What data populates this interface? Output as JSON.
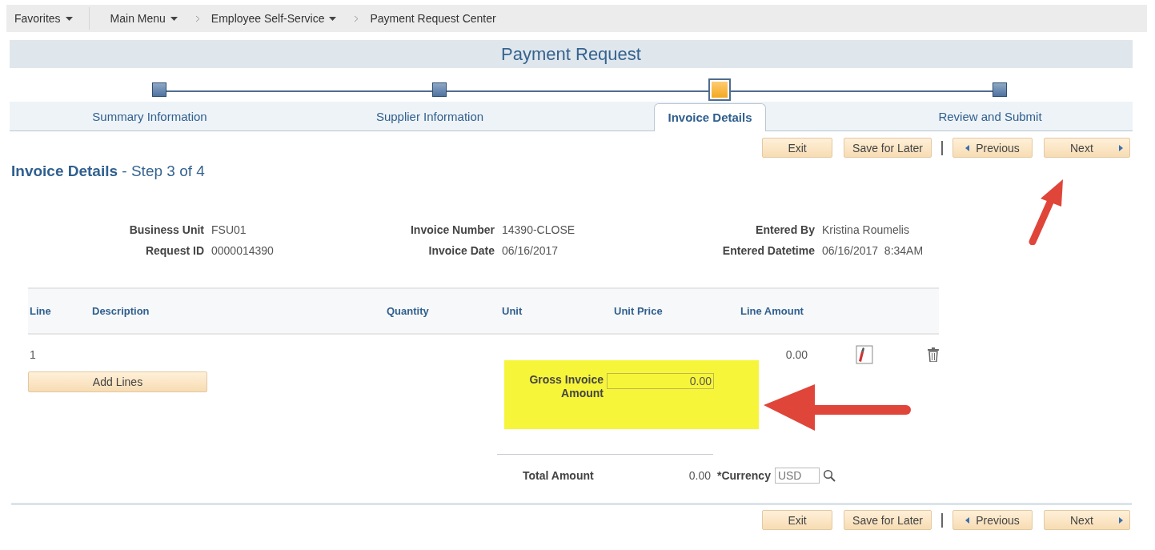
{
  "nav": [
    {
      "label": "Favorites",
      "dropdown": true
    },
    {
      "label": "Main Menu",
      "dropdown": true
    },
    {
      "label": "Employee Self-Service",
      "dropdown": true
    },
    {
      "label": "Payment Request Center",
      "dropdown": false
    }
  ],
  "page_title": "Payment Request",
  "steps": [
    {
      "label": "Summary Information",
      "selected": false
    },
    {
      "label": "Supplier Information",
      "selected": false
    },
    {
      "label": "Invoice Details",
      "selected": true
    },
    {
      "label": "Review and Submit",
      "selected": false
    }
  ],
  "top_buttons": [
    {
      "label": "Exit",
      "kind": "plain"
    },
    {
      "label": "Save for Later",
      "kind": "plain"
    },
    {
      "label": "Previous",
      "kind": "back"
    },
    {
      "label": "Next",
      "kind": "forward"
    }
  ],
  "heading": {
    "title": "Invoice Details",
    "subtitle": "- Step 3 of 4"
  },
  "fields": [
    {
      "label": "Business Unit",
      "value": "FSU01"
    },
    {
      "label": "Invoice Number",
      "value": "14390-CLOSE"
    },
    {
      "label": "Entered By",
      "value": "Kristina Roumelis"
    },
    {
      "label": "Request ID",
      "value": "0000014390"
    },
    {
      "label": "Invoice Date",
      "value": "06/16/2017"
    },
    {
      "label": "Entered Datetime",
      "value": "06/16/2017  8:34AM"
    }
  ],
  "table": {
    "columns": [
      "Line",
      "Description",
      "Quantity",
      "Unit",
      "Unit Price",
      "Line Amount"
    ],
    "rows": [
      {
        "line": "1",
        "line_amount": "0.00"
      }
    ]
  },
  "add_lines_button": "Add Lines",
  "gross_invoice": {
    "label": "Gross Invoice Amount",
    "value": "0.00"
  },
  "total": {
    "label": "Total Amount",
    "value": "0.00"
  },
  "currency": {
    "label": "*Currency",
    "value": "USD"
  },
  "bottom_buttons": [
    {
      "label": "Exit",
      "kind": "plain"
    },
    {
      "label": "Save for Later",
      "kind": "plain"
    },
    {
      "label": "Previous",
      "kind": "back"
    },
    {
      "label": "Next",
      "kind": "forward"
    }
  ]
}
